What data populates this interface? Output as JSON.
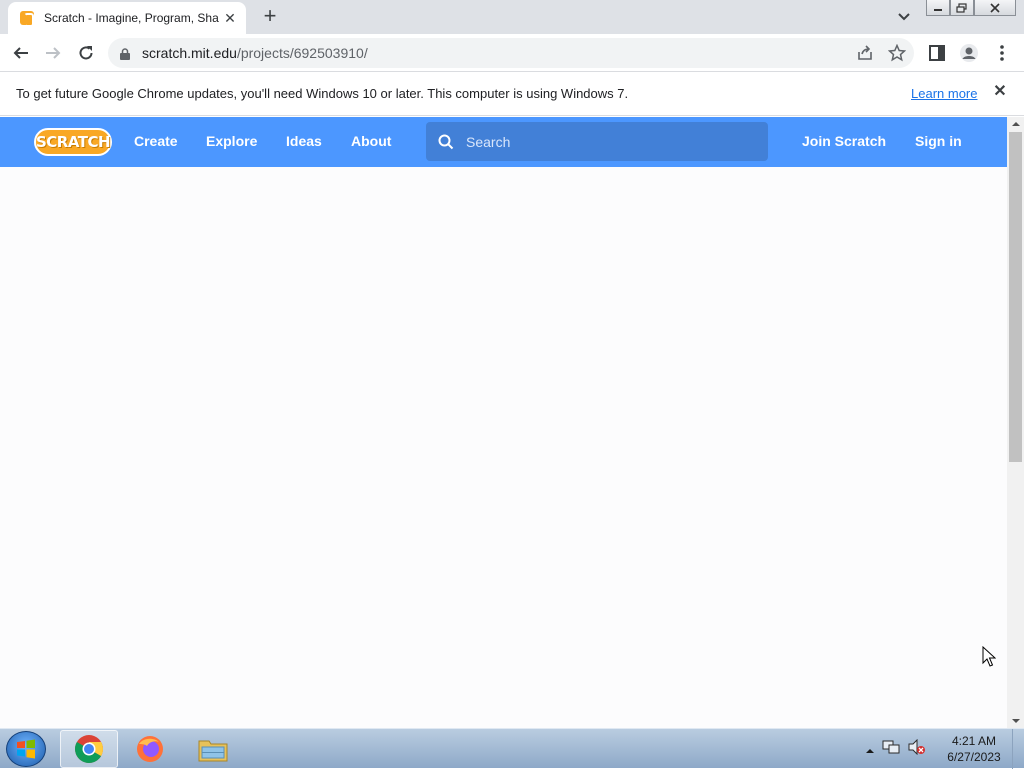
{
  "browser": {
    "tab_title": "Scratch - Imagine, Program, Share",
    "tab_close": "✕",
    "new_tab": "+",
    "url_host": "scratch.mit.edu",
    "url_path": "/projects/692503910/"
  },
  "infobar": {
    "message": "To get future Google Chrome updates, you'll need Windows 10 or later. This computer is using Windows 7.",
    "learn_more": "Learn more",
    "close": "✕"
  },
  "scratch": {
    "logo": "SCRATCH",
    "nav": {
      "create": "Create",
      "explore": "Explore",
      "ideas": "Ideas",
      "about": "About"
    },
    "search_placeholder": "Search",
    "join": "Join Scratch",
    "sign_in": "Sign in",
    "brand_color": "#4c97ff"
  },
  "taskbar": {
    "time": "4:21 AM",
    "date": "6/27/2023"
  }
}
